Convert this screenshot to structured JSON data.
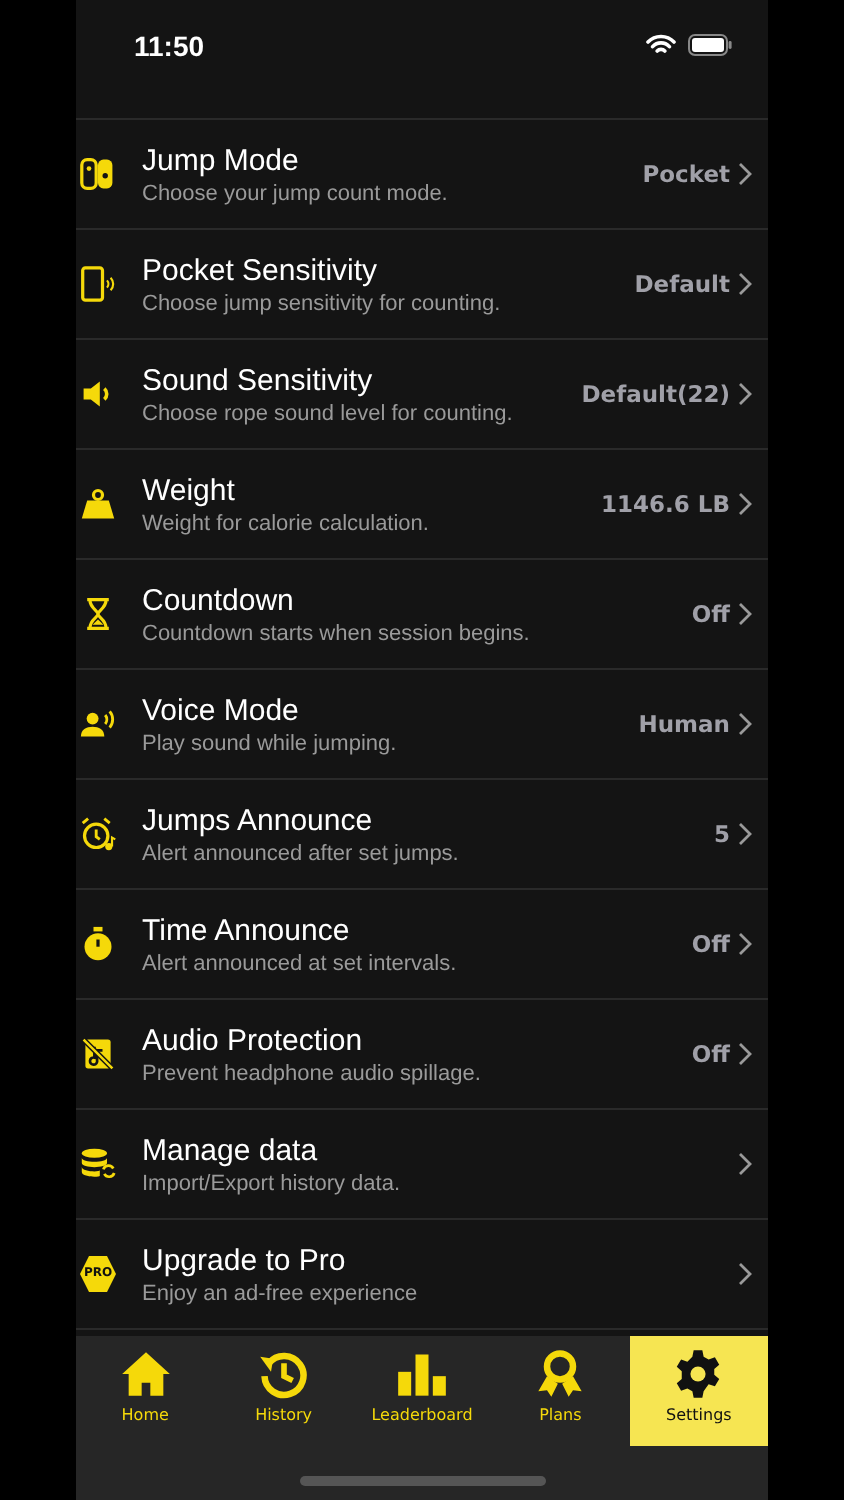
{
  "status_bar": {
    "time": "11:50"
  },
  "settings": [
    {
      "title": "Jump Mode",
      "subtitle": "Choose your jump count mode.",
      "value": "Pocket"
    },
    {
      "title": "Pocket Sensitivity",
      "subtitle": "Choose jump sensitivity for counting.",
      "value": "Default"
    },
    {
      "title": "Sound Sensitivity",
      "subtitle": "Choose rope sound level for counting.",
      "value": "Default(22)"
    },
    {
      "title": "Weight",
      "subtitle": "Weight for calorie calculation.",
      "value": "1146.6 LB"
    },
    {
      "title": "Countdown",
      "subtitle": "Countdown starts when session begins.",
      "value": "Off"
    },
    {
      "title": "Voice Mode",
      "subtitle": "Play sound while jumping.",
      "value": "Human"
    },
    {
      "title": "Jumps Announce",
      "subtitle": "Alert announced after set jumps.",
      "value": "5"
    },
    {
      "title": "Time Announce",
      "subtitle": "Alert announced at set intervals.",
      "value": "Off"
    },
    {
      "title": "Audio Protection",
      "subtitle": "Prevent headphone audio spillage.",
      "value": "Off"
    },
    {
      "title": "Manage data",
      "subtitle": "Import/Export history data."
    },
    {
      "badge": "PRO",
      "title": "Upgrade to Pro",
      "subtitle": "Enjoy an ad-free experience"
    }
  ],
  "tabs": [
    {
      "label": "Home",
      "selected": false
    },
    {
      "label": "History",
      "selected": false
    },
    {
      "label": "Leaderboard",
      "selected": false
    },
    {
      "label": "Plans",
      "selected": false
    },
    {
      "label": "Settings",
      "selected": true
    }
  ]
}
